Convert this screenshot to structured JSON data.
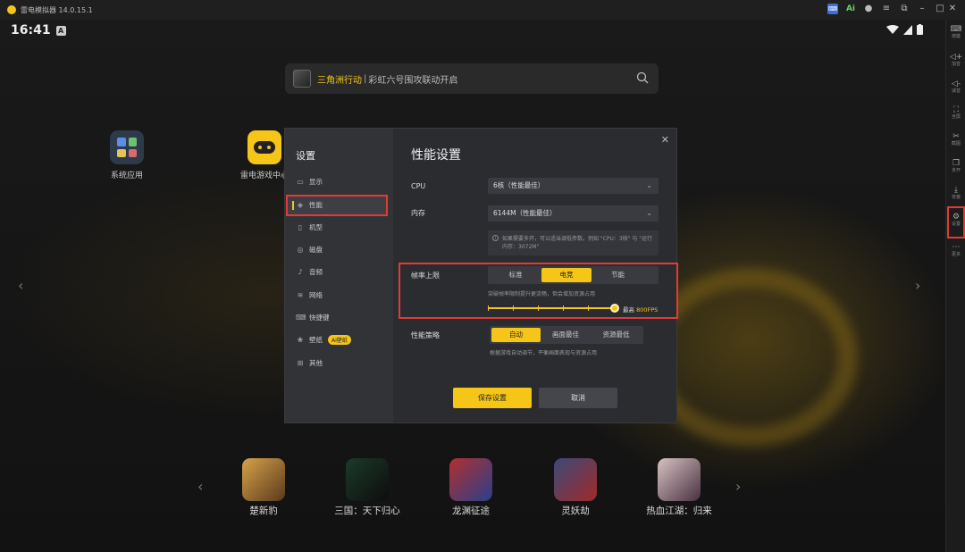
{
  "window": {
    "title": "雷电模拟器 14.0.15.1"
  },
  "titlebar_icons": [
    "keyboard-icon",
    "ai-icon",
    "user-icon",
    "menu-icon",
    "restore-icon",
    "minimize-icon",
    "maximize-icon",
    "close-icon"
  ],
  "status": {
    "time": "16:41",
    "badge": "A"
  },
  "sidebar": {
    "items": [
      {
        "label": "按键",
        "icon": "keyboard-icon",
        "glyph": "⌨"
      },
      {
        "label": "加音",
        "icon": "volume-up-icon",
        "glyph": "◁+"
      },
      {
        "label": "减音",
        "icon": "volume-down-icon",
        "glyph": "◁-"
      },
      {
        "label": "全屏",
        "icon": "fullscreen-icon",
        "glyph": "⛶"
      },
      {
        "label": "截图",
        "icon": "scissors-icon",
        "glyph": "✂"
      },
      {
        "label": "多开",
        "icon": "multi-window-icon",
        "glyph": "❐"
      },
      {
        "label": "安装",
        "icon": "install-icon",
        "glyph": "⤓"
      },
      {
        "label": "设置",
        "icon": "gear-icon",
        "glyph": "⚙"
      },
      {
        "label": "更多",
        "icon": "more-icon",
        "glyph": "⋯"
      }
    ]
  },
  "search": {
    "highlight": "三角洲行动",
    "separator": "|",
    "text": "彩虹六号围攻联动开启"
  },
  "desktop": {
    "apps": [
      {
        "label": "系统应用"
      },
      {
        "label": "雷电游戏中心"
      }
    ]
  },
  "dock": {
    "apps": [
      {
        "label": "楚新豹"
      },
      {
        "label": "三国：天下归心"
      },
      {
        "label": "龙渊征途"
      },
      {
        "label": "灵妖劫"
      },
      {
        "label": "热血江湖：归来"
      }
    ]
  },
  "dialog": {
    "title": "设置",
    "heading": "性能设置",
    "menu": [
      {
        "label": "显示",
        "icon": "monitor-icon",
        "glyph": "▭"
      },
      {
        "label": "性能",
        "icon": "performance-icon",
        "glyph": "◈"
      },
      {
        "label": "机型",
        "icon": "phone-icon",
        "glyph": "▯"
      },
      {
        "label": "磁盘",
        "icon": "disk-icon",
        "glyph": "◎"
      },
      {
        "label": "音频",
        "icon": "audio-icon",
        "glyph": "♪"
      },
      {
        "label": "网络",
        "icon": "wifi-icon",
        "glyph": "≋"
      },
      {
        "label": "快捷键",
        "icon": "keyboard-icon",
        "glyph": "⌨"
      },
      {
        "label": "壁纸",
        "icon": "wallpaper-icon",
        "glyph": "❀",
        "badge": "AI壁纸"
      },
      {
        "label": "其他",
        "icon": "grid-icon",
        "glyph": "⊞"
      }
    ],
    "active_menu": "性能",
    "cpu": {
      "label": "CPU",
      "value": "6核（性能最佳）"
    },
    "memory": {
      "label": "内存",
      "value": "6144M（性能最佳）"
    },
    "tip": "如果需要多开，可以适当调低参数。例如 \"CPU：3核\" 与 \"运行内存：3072M\"",
    "fps": {
      "label": "帧率上限",
      "options": [
        "标准",
        "电竞",
        "节能"
      ],
      "selected": "电竞",
      "note": "突破帧率限制提升更流畅，但会增加资源占用",
      "slider_label": "最高",
      "slider_value": "800FPS",
      "slider_fraction": 1.0
    },
    "strategy": {
      "label": "性能策略",
      "options": [
        "自动",
        "画面最佳",
        "资源最低"
      ],
      "selected": "自动",
      "note": "根据游戏自动调节，平衡画面表现与资源占用"
    },
    "buttons": {
      "save": "保存设置",
      "cancel": "取消"
    }
  }
}
